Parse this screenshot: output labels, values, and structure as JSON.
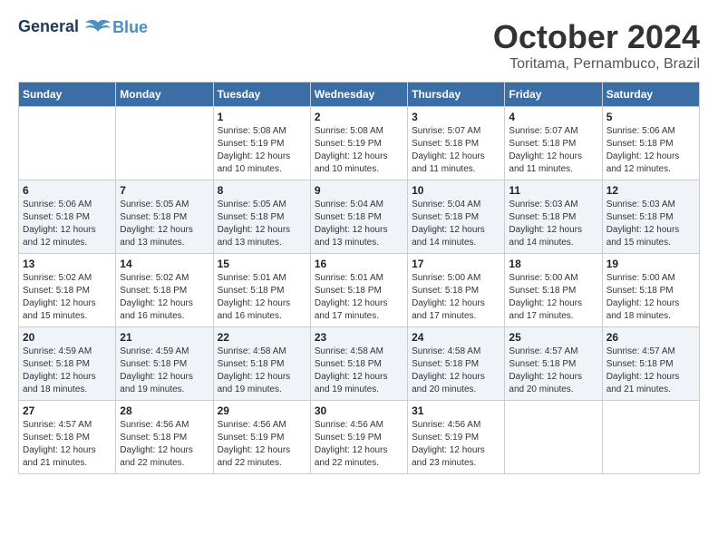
{
  "header": {
    "logo_line1": "General",
    "logo_line2": "Blue",
    "month": "October 2024",
    "location": "Toritama, Pernambuco, Brazil"
  },
  "days_of_week": [
    "Sunday",
    "Monday",
    "Tuesday",
    "Wednesday",
    "Thursday",
    "Friday",
    "Saturday"
  ],
  "weeks": [
    [
      {
        "day": "",
        "detail": ""
      },
      {
        "day": "",
        "detail": ""
      },
      {
        "day": "1",
        "detail": "Sunrise: 5:08 AM\nSunset: 5:19 PM\nDaylight: 12 hours\nand 10 minutes."
      },
      {
        "day": "2",
        "detail": "Sunrise: 5:08 AM\nSunset: 5:19 PM\nDaylight: 12 hours\nand 10 minutes."
      },
      {
        "day": "3",
        "detail": "Sunrise: 5:07 AM\nSunset: 5:18 PM\nDaylight: 12 hours\nand 11 minutes."
      },
      {
        "day": "4",
        "detail": "Sunrise: 5:07 AM\nSunset: 5:18 PM\nDaylight: 12 hours\nand 11 minutes."
      },
      {
        "day": "5",
        "detail": "Sunrise: 5:06 AM\nSunset: 5:18 PM\nDaylight: 12 hours\nand 12 minutes."
      }
    ],
    [
      {
        "day": "6",
        "detail": "Sunrise: 5:06 AM\nSunset: 5:18 PM\nDaylight: 12 hours\nand 12 minutes."
      },
      {
        "day": "7",
        "detail": "Sunrise: 5:05 AM\nSunset: 5:18 PM\nDaylight: 12 hours\nand 13 minutes."
      },
      {
        "day": "8",
        "detail": "Sunrise: 5:05 AM\nSunset: 5:18 PM\nDaylight: 12 hours\nand 13 minutes."
      },
      {
        "day": "9",
        "detail": "Sunrise: 5:04 AM\nSunset: 5:18 PM\nDaylight: 12 hours\nand 13 minutes."
      },
      {
        "day": "10",
        "detail": "Sunrise: 5:04 AM\nSunset: 5:18 PM\nDaylight: 12 hours\nand 14 minutes."
      },
      {
        "day": "11",
        "detail": "Sunrise: 5:03 AM\nSunset: 5:18 PM\nDaylight: 12 hours\nand 14 minutes."
      },
      {
        "day": "12",
        "detail": "Sunrise: 5:03 AM\nSunset: 5:18 PM\nDaylight: 12 hours\nand 15 minutes."
      }
    ],
    [
      {
        "day": "13",
        "detail": "Sunrise: 5:02 AM\nSunset: 5:18 PM\nDaylight: 12 hours\nand 15 minutes."
      },
      {
        "day": "14",
        "detail": "Sunrise: 5:02 AM\nSunset: 5:18 PM\nDaylight: 12 hours\nand 16 minutes."
      },
      {
        "day": "15",
        "detail": "Sunrise: 5:01 AM\nSunset: 5:18 PM\nDaylight: 12 hours\nand 16 minutes."
      },
      {
        "day": "16",
        "detail": "Sunrise: 5:01 AM\nSunset: 5:18 PM\nDaylight: 12 hours\nand 17 minutes."
      },
      {
        "day": "17",
        "detail": "Sunrise: 5:00 AM\nSunset: 5:18 PM\nDaylight: 12 hours\nand 17 minutes."
      },
      {
        "day": "18",
        "detail": "Sunrise: 5:00 AM\nSunset: 5:18 PM\nDaylight: 12 hours\nand 17 minutes."
      },
      {
        "day": "19",
        "detail": "Sunrise: 5:00 AM\nSunset: 5:18 PM\nDaylight: 12 hours\nand 18 minutes."
      }
    ],
    [
      {
        "day": "20",
        "detail": "Sunrise: 4:59 AM\nSunset: 5:18 PM\nDaylight: 12 hours\nand 18 minutes."
      },
      {
        "day": "21",
        "detail": "Sunrise: 4:59 AM\nSunset: 5:18 PM\nDaylight: 12 hours\nand 19 minutes."
      },
      {
        "day": "22",
        "detail": "Sunrise: 4:58 AM\nSunset: 5:18 PM\nDaylight: 12 hours\nand 19 minutes."
      },
      {
        "day": "23",
        "detail": "Sunrise: 4:58 AM\nSunset: 5:18 PM\nDaylight: 12 hours\nand 19 minutes."
      },
      {
        "day": "24",
        "detail": "Sunrise: 4:58 AM\nSunset: 5:18 PM\nDaylight: 12 hours\nand 20 minutes."
      },
      {
        "day": "25",
        "detail": "Sunrise: 4:57 AM\nSunset: 5:18 PM\nDaylight: 12 hours\nand 20 minutes."
      },
      {
        "day": "26",
        "detail": "Sunrise: 4:57 AM\nSunset: 5:18 PM\nDaylight: 12 hours\nand 21 minutes."
      }
    ],
    [
      {
        "day": "27",
        "detail": "Sunrise: 4:57 AM\nSunset: 5:18 PM\nDaylight: 12 hours\nand 21 minutes."
      },
      {
        "day": "28",
        "detail": "Sunrise: 4:56 AM\nSunset: 5:18 PM\nDaylight: 12 hours\nand 22 minutes."
      },
      {
        "day": "29",
        "detail": "Sunrise: 4:56 AM\nSunset: 5:19 PM\nDaylight: 12 hours\nand 22 minutes."
      },
      {
        "day": "30",
        "detail": "Sunrise: 4:56 AM\nSunset: 5:19 PM\nDaylight: 12 hours\nand 22 minutes."
      },
      {
        "day": "31",
        "detail": "Sunrise: 4:56 AM\nSunset: 5:19 PM\nDaylight: 12 hours\nand 23 minutes."
      },
      {
        "day": "",
        "detail": ""
      },
      {
        "day": "",
        "detail": ""
      }
    ]
  ]
}
